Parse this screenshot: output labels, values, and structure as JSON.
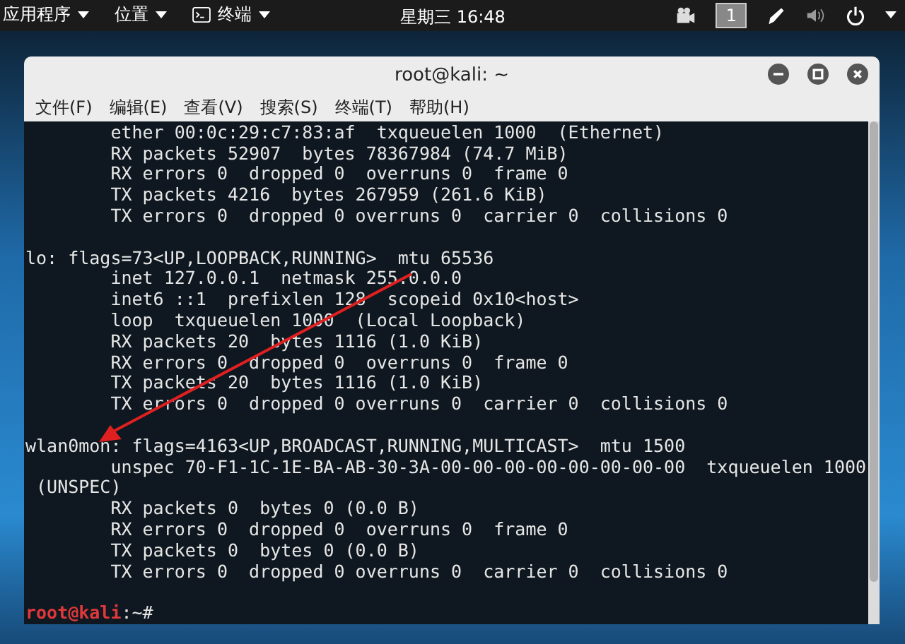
{
  "top_bar": {
    "menus": [
      "应用程序",
      "位置",
      "终端"
    ],
    "clock": "星期三 16:48",
    "workspace": "1"
  },
  "window": {
    "title": "root@kali: ~"
  },
  "menu_bar": [
    "文件(F)",
    "编辑(E)",
    "查看(V)",
    "搜索(S)",
    "终端(T)",
    "帮助(H)"
  ],
  "terminal": {
    "blocks": [
      [
        "        ether 00:0c:29:c7:83:af  txqueuelen 1000  (Ethernet)",
        "        RX packets 52907  bytes 78367984 (74.7 MiB)",
        "        RX errors 0  dropped 0  overruns 0  frame 0",
        "        TX packets 4216  bytes 267959 (261.6 KiB)",
        "        TX errors 0  dropped 0 overruns 0  carrier 0  collisions 0"
      ],
      [
        "lo: flags=73<UP,LOOPBACK,RUNNING>  mtu 65536",
        "        inet 127.0.0.1  netmask 255.0.0.0",
        "        inet6 ::1  prefixlen 128  scopeid 0x10<host>",
        "        loop  txqueuelen 1000  (Local Loopback)",
        "        RX packets 20  bytes 1116 (1.0 KiB)",
        "        RX errors 0  dropped 0  overruns 0  frame 0",
        "        TX packets 20  bytes 1116 (1.0 KiB)",
        "        TX errors 0  dropped 0 overruns 0  carrier 0  collisions 0"
      ],
      [
        "wlan0mon: flags=4163<UP,BROADCAST,RUNNING,MULTICAST>  mtu 1500",
        "        unspec 70-F1-1C-1E-BA-AB-30-3A-00-00-00-00-00-00-00-00  txqueuelen 1000",
        " (UNSPEC)",
        "        RX packets 0  bytes 0 (0.0 B)",
        "        RX errors 0  dropped 0  overruns 0  frame 0",
        "        TX packets 0  bytes 0 (0.0 B)",
        "        TX errors 0  dropped 0 overruns 0  carrier 0  collisions 0"
      ]
    ],
    "prompt": {
      "user_host": "root@kali",
      "path": ":~#"
    }
  }
}
